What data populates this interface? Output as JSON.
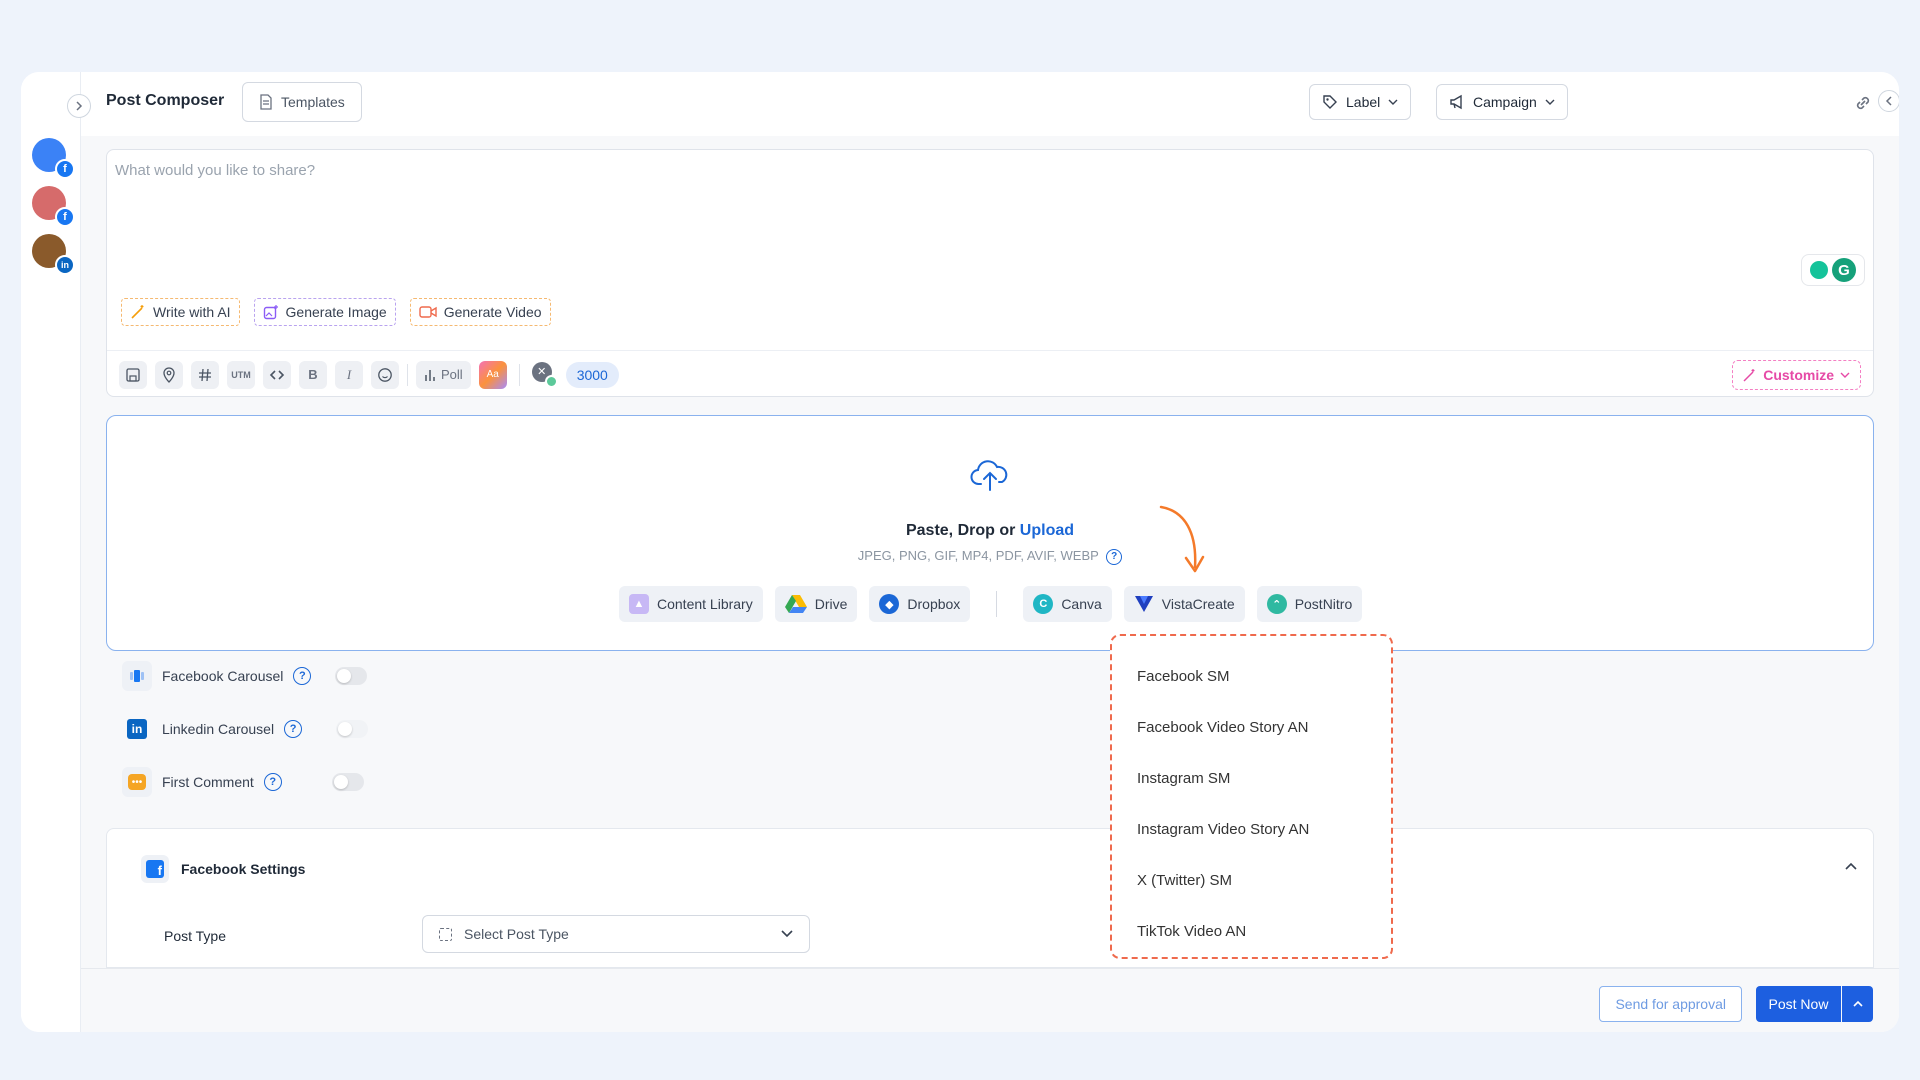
{
  "header": {
    "title": "Post Composer",
    "templates_label": "Templates",
    "label_button": "Label",
    "campaign_button": "Campaign"
  },
  "composer": {
    "placeholder": "What would you like to share?",
    "ai_buttons": {
      "write": "Write with AI",
      "image": "Generate Image",
      "video": "Generate Video"
    },
    "toolbar": {
      "utm": "UTM",
      "bold": "B",
      "italic": "I",
      "poll": "Poll",
      "char_count": "3000"
    },
    "customize_label": "Customize"
  },
  "media": {
    "paste_drop_or": "Paste, Drop or",
    "upload": "Upload",
    "formats": "JPEG, PNG, GIF, MP4, PDF, AVIF, WEBP",
    "sources": {
      "content_library": "Content Library",
      "drive": "Drive",
      "dropbox": "Dropbox",
      "canva": "Canva",
      "vistacreate": "VistaCreate",
      "postnitro": "PostNitro"
    }
  },
  "vistacreate_menu": [
    "Facebook SM",
    "Facebook Video Story AN",
    "Instagram SM",
    "Instagram Video Story AN",
    "X (Twitter) SM",
    "TikTok Video AN"
  ],
  "options": {
    "facebook_carousel": "Facebook Carousel",
    "linkedin_carousel": "Linkedin Carousel",
    "first_comment": "First Comment"
  },
  "facebook_settings": {
    "title": "Facebook Settings",
    "post_type_label": "Post Type",
    "post_type_placeholder": "Select Post Type"
  },
  "footer": {
    "send_for_approval": "Send for approval",
    "post_now": "Post Now"
  },
  "colors": {
    "primary": "#1d5fe0",
    "accent_pink": "#e64aa6",
    "annotation_orange": "#ef6a4d",
    "facebook": "#1877f2",
    "linkedin": "#0a66c2"
  }
}
